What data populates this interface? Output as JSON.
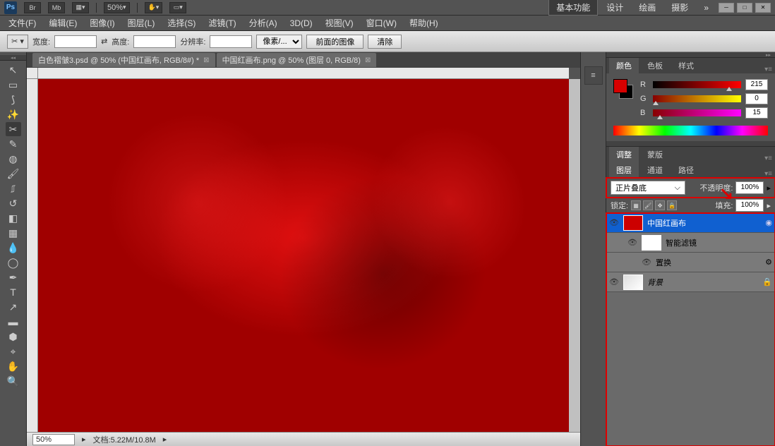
{
  "topbar": {
    "logo": "Ps",
    "buttons": [
      "Br",
      "Mb"
    ],
    "zoom": "50%",
    "workspaces": {
      "active": "基本功能",
      "items": [
        "设计",
        "绘画",
        "摄影"
      ],
      "more": "»"
    }
  },
  "menu": [
    "文件(F)",
    "编辑(E)",
    "图像(I)",
    "图层(L)",
    "选择(S)",
    "滤镜(T)",
    "分析(A)",
    "3D(D)",
    "视图(V)",
    "窗口(W)",
    "帮助(H)"
  ],
  "options": {
    "width_label": "宽度:",
    "height_label": "高度:",
    "resolution_label": "分辨率:",
    "unit": "像素/...",
    "front_image": "前面的图像",
    "clear": "清除"
  },
  "tabs": [
    {
      "title": "白色褶皱3.psd @ 50% (中国红画布, RGB/8#) *"
    },
    {
      "title": "中国红画布.png @ 50% (图层 0, RGB/8)"
    }
  ],
  "status": {
    "zoom": "50%",
    "doc": "文档:5.22M/10.8M"
  },
  "color_panel": {
    "tabs": [
      "颜色",
      "色板",
      "样式"
    ],
    "r": {
      "label": "R",
      "value": "215"
    },
    "g": {
      "label": "G",
      "value": "0"
    },
    "b": {
      "label": "B",
      "value": "15"
    }
  },
  "adjust_tabs": [
    "调整",
    "蒙版"
  ],
  "layers": {
    "tabs": [
      "图层",
      "通道",
      "路径"
    ],
    "blend_mode": "正片叠底",
    "opacity_label": "不透明度:",
    "opacity_value": "100%",
    "lock_label": "锁定:",
    "fill_label": "填充:",
    "fill_value": "100%",
    "items": [
      {
        "name": "中国红画布",
        "selected": true
      },
      {
        "name": "智能滤镜",
        "sub": true
      },
      {
        "name": "置换",
        "sub": true,
        "deeper": true
      },
      {
        "name": "背景"
      }
    ]
  }
}
